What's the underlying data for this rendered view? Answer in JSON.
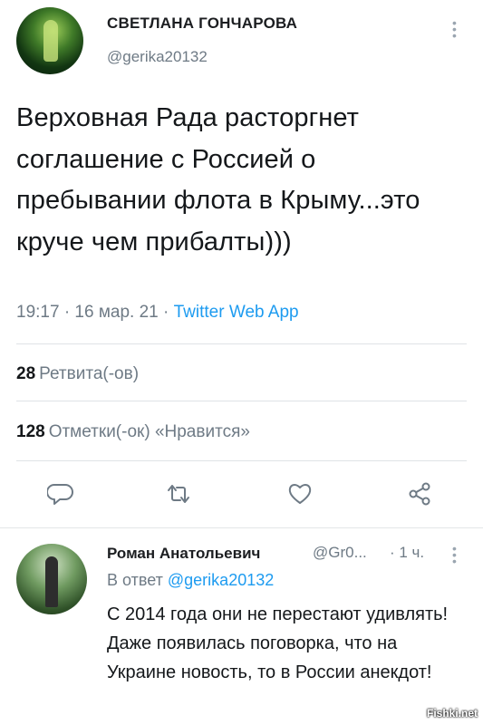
{
  "tweet": {
    "author_name": "СВЕТЛАНА ГОНЧАРОВА",
    "handle": "@gerika20132",
    "text": "Верховная Рада расторгнет соглашение с Россией о пребывании флота в Крыму...это круче чем прибалты)))",
    "time": "19:17 · 16 мар. 21 · ",
    "app": "Twitter Web App",
    "retweets_count": "28",
    "retweets_label": "Ретвита(-ов)",
    "likes_count": "128",
    "likes_label": "Отметки(-ок) «Нравится»"
  },
  "actions": {
    "reply_icon": "reply-icon",
    "retweet_icon": "retweet-icon",
    "like_icon": "heart-icon",
    "share_icon": "share-icon"
  },
  "reply": {
    "author_name": "Роман Анатольевич",
    "handle": "@Gr0...",
    "time": "· 1 ч.",
    "reply_to_label": "В ответ ",
    "reply_to_handle": "@gerika20132",
    "text": "С 2014 года они не перестают удивлять! Даже появилась поговорка, что на Украине новость, то в России анекдот!"
  },
  "watermark": "Fishki.net",
  "colors": {
    "link": "#1d9bf0",
    "secondary_text": "#6e7a85",
    "primary_text": "#14171a"
  }
}
